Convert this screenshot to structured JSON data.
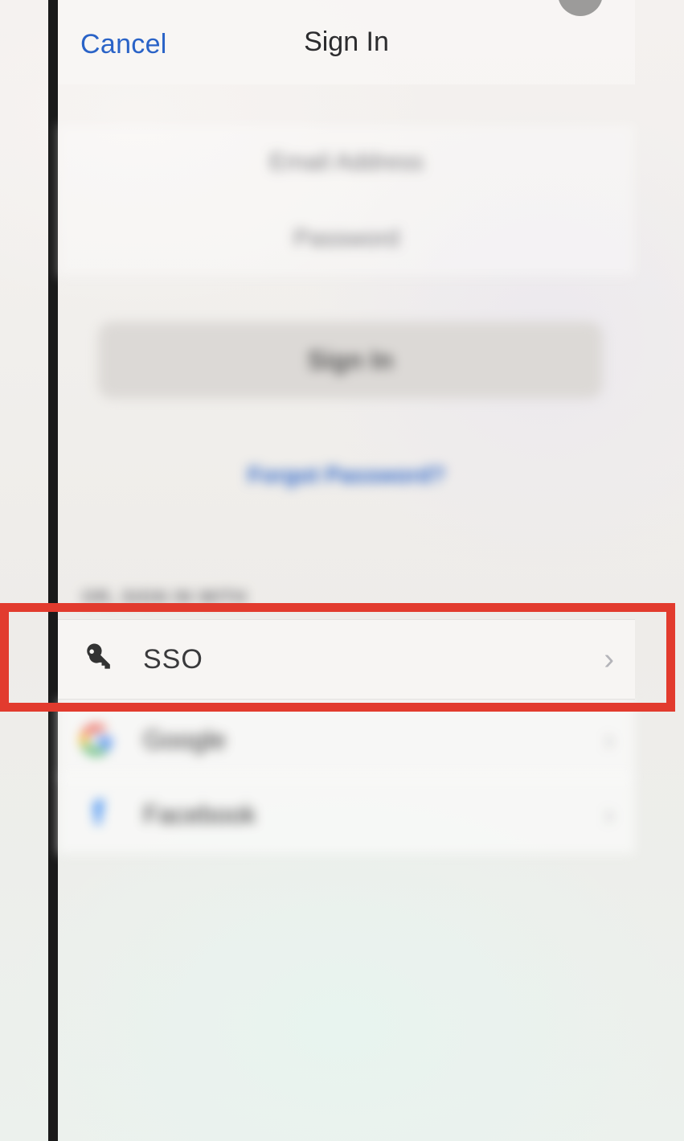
{
  "nav": {
    "cancel": "Cancel",
    "title": "Sign In"
  },
  "form": {
    "email_placeholder": "Email Address",
    "password_placeholder": "Password"
  },
  "actions": {
    "signin": "Sign In",
    "forgot": "Forgot Password?"
  },
  "alt_label": "OR, SIGN IN WITH",
  "options": {
    "sso": "SSO",
    "google": "Google",
    "facebook": "Facebook"
  }
}
